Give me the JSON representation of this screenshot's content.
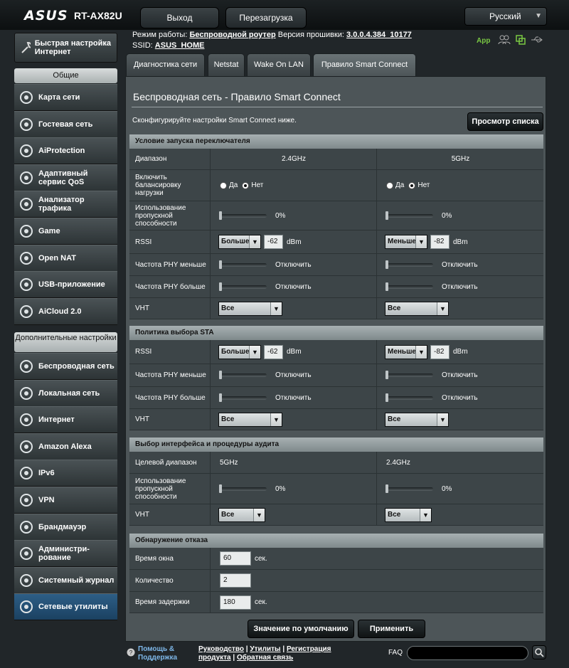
{
  "header": {
    "brand": "ASUS",
    "model": "RT-AX82U",
    "logout": "Выход",
    "reboot": "Перезагрузка",
    "language": "Русский"
  },
  "info": {
    "mode_label": "Режим работы:",
    "mode_value": "Беспроводной роутер",
    "fw_label": "Версия прошивки:",
    "fw_value": "3.0.0.4.384_10177",
    "ssid_label": "SSID:",
    "ssid_value": "ASUS_HOME",
    "app_label": "App"
  },
  "sidebar": {
    "quick_setup": "Быстрая настройка Интернет",
    "general_title": "Общие",
    "general": [
      {
        "label": "Карта сети",
        "icon": "network-map-icon"
      },
      {
        "label": "Гостевая сеть",
        "icon": "guest-network-icon"
      },
      {
        "label": "AiProtection",
        "icon": "aiprotection-icon"
      },
      {
        "label": "Адаптивный сервис QoS",
        "icon": "qos-icon"
      },
      {
        "label": "Анализатор трафика",
        "icon": "traffic-analyzer-icon"
      },
      {
        "label": "Game",
        "icon": "game-icon"
      },
      {
        "label": "Open NAT",
        "icon": "open-nat-icon"
      },
      {
        "label": "USB-приложение",
        "icon": "usb-app-icon"
      },
      {
        "label": "AiCloud 2.0",
        "icon": "aicloud-icon"
      }
    ],
    "advanced_title": "Дополнительные настройки",
    "advanced": [
      {
        "label": "Беспроводная сеть",
        "icon": "wireless-icon"
      },
      {
        "label": "Локальная сеть",
        "icon": "lan-icon"
      },
      {
        "label": "Интернет",
        "icon": "internet-icon"
      },
      {
        "label": "Amazon Alexa",
        "icon": "alexa-icon"
      },
      {
        "label": "IPv6",
        "icon": "ipv6-icon"
      },
      {
        "label": "VPN",
        "icon": "vpn-icon"
      },
      {
        "label": "Брандмауэр",
        "icon": "firewall-icon"
      },
      {
        "label": "Администри-рование",
        "icon": "administration-icon"
      },
      {
        "label": "Системный журнал",
        "icon": "system-log-icon"
      },
      {
        "label": "Сетевые утилиты",
        "icon": "network-tools-icon"
      }
    ]
  },
  "tabs": [
    "Диагностика сети",
    "Netstat",
    "Wake On LAN",
    "Правило Smart Connect"
  ],
  "panel": {
    "title": "Беспроводная сеть - Правило Smart Connect",
    "desc": "Сконфигурируйте настройки Smart Connect ниже.",
    "view_list": "Просмотр списка"
  },
  "sec1": {
    "title": "Условие запуска переключателя",
    "band_label": "Диапазон",
    "band1": "2.4GHz",
    "band2": "5GHz",
    "lb_label": "Включить балансировку нагрузки",
    "yes": "Да",
    "no": "Нет",
    "bw_label": "Использование пропускной способности",
    "bw1": "0%",
    "bw2": "0%",
    "rssi_label": "RSSI",
    "rssi1_op": "Больше",
    "rssi1": "-62",
    "rssi2_op": "Меньше",
    "rssi2": "-82",
    "unit": "dBm",
    "phy_lt_label": "Частота PHY меньше",
    "phy_gt_label": "Частота PHY больше",
    "off": "Отключить",
    "vht_label": "VHT",
    "vht1": "Все",
    "vht2": "Все"
  },
  "sec2": {
    "title": "Политика выбора STA",
    "rssi_label": "RSSI",
    "rssi1_op": "Больше",
    "rssi1": "-62",
    "rssi2_op": "Меньше",
    "rssi2": "-82",
    "unit": "dBm",
    "phy_lt_label": "Частота PHY меньше",
    "phy_gt_label": "Частота PHY больше",
    "off": "Отключить",
    "vht_label": "VHT",
    "vht1": "Все",
    "vht2": "Все"
  },
  "sec3": {
    "title": "Выбор интерфейса и процедуры аудита",
    "target_label": "Целевой диапазон",
    "target1": "5GHz",
    "target2": "2.4GHz",
    "bw_label": "Использование пропускной способности",
    "bw1": "0%",
    "bw2": "0%",
    "vht_label": "VHT",
    "vht1": "Все",
    "vht2": "Все"
  },
  "sec4": {
    "title": "Обнаружение отказа",
    "window_label": "Время окна",
    "window": "60",
    "sec": "сек.",
    "count_label": "Количество",
    "count": "2",
    "delay_label": "Время задержки",
    "delay": "180"
  },
  "buttons": {
    "default": "Значение по умолчанию",
    "apply": "Применить"
  },
  "footer": {
    "help": "Помощь & Поддержка",
    "manual": "Руководство",
    "utils": "Утилиты",
    "reg": "Регистрация",
    "product": "продукта",
    "feedback": "Обратная связь",
    "faq": "FAQ"
  }
}
